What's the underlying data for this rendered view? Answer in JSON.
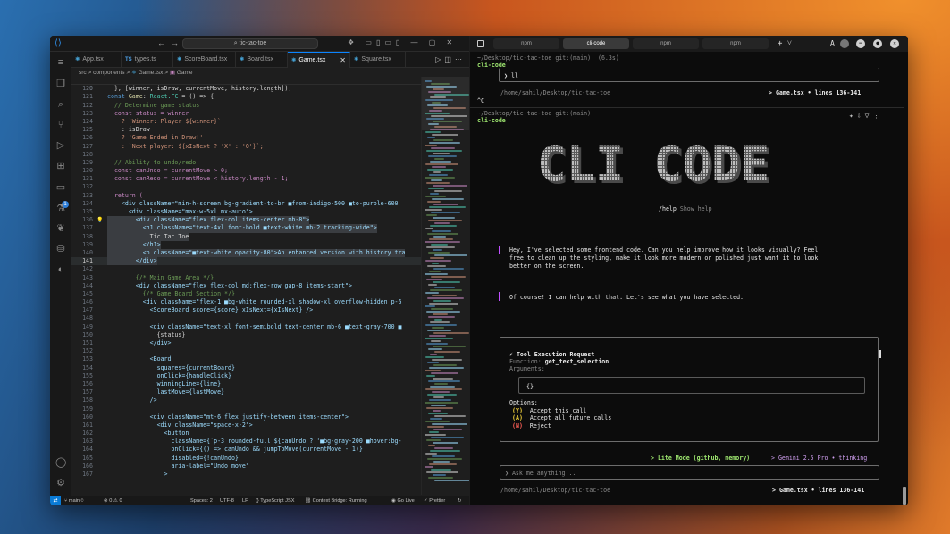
{
  "editor": {
    "search": "tic-tac-toe",
    "tabs": [
      {
        "icon": "⚛",
        "label": "App.tsx"
      },
      {
        "icon": "TS",
        "label": "types.ts"
      },
      {
        "icon": "⚛",
        "label": "ScoreBoard.tsx"
      },
      {
        "icon": "⚛",
        "label": "Board.tsx"
      },
      {
        "icon": "⚛",
        "label": "Game.tsx"
      },
      {
        "icon": "⚛",
        "label": "Square.tsx"
      }
    ],
    "breadcrumb": {
      "p1": "src",
      "p2": "components",
      "p3": "Game.tsx",
      "p4": "Game"
    },
    "sticky": {
      "ln": "9",
      "text": "const Game: React.FC = () => {"
    },
    "lines": [
      {
        "n": "120",
        "t": "  }, [winner, isDraw, currentMove, history.length]);"
      },
      {
        "n": "121",
        "t": ""
      },
      {
        "n": "122",
        "t": "  // Determine game status"
      },
      {
        "n": "123",
        "t": "  const status = winner"
      },
      {
        "n": "124",
        "t": "    ? `Winner: Player ${winner}`"
      },
      {
        "n": "125",
        "t": "    : isDraw"
      },
      {
        "n": "126",
        "t": "    ? 'Game Ended in Draw!'"
      },
      {
        "n": "127",
        "t": "    : `Next player: ${xIsNext ? 'X' : 'O'}`;"
      },
      {
        "n": "128",
        "t": ""
      },
      {
        "n": "129",
        "t": "  // Ability to undo/redo"
      },
      {
        "n": "130",
        "t": "  const canUndo = currentMove > 0;"
      },
      {
        "n": "131",
        "t": "  const canRedo = currentMove < history.length - 1;"
      },
      {
        "n": "132",
        "t": ""
      },
      {
        "n": "133",
        "t": "  return ("
      },
      {
        "n": "134",
        "t": "    <div className=\"min-h-screen bg-gradient-to-br ■from-indigo-500 ■to-purple-600"
      },
      {
        "n": "135",
        "t": "      <div className=\"max-w-5xl mx-auto\">"
      },
      {
        "n": "136",
        "t": "        <div className=\"flex flex-col items-center mb-8\">"
      },
      {
        "n": "137",
        "t": "          <h1 className=\"text-4xl font-bold ■text-white mb-2 tracking-wide\">"
      },
      {
        "n": "138",
        "t": "            Tic Tac Toe"
      },
      {
        "n": "139",
        "t": "          </h1>"
      },
      {
        "n": "140",
        "t": "          <p className=\"■text-white opacity-80\">An enhanced version with history tra"
      },
      {
        "n": "141",
        "t": "        </div>"
      },
      {
        "n": "142",
        "t": ""
      },
      {
        "n": "143",
        "t": "        {/* Main Game Area */}"
      },
      {
        "n": "144",
        "t": "        <div className=\"flex flex-col md:flex-row gap-8 items-start\">"
      },
      {
        "n": "145",
        "t": "          {/* Game Board Section */}"
      },
      {
        "n": "146",
        "t": "          <div className=\"flex-1 ■bg-white rounded-xl shadow-xl overflow-hidden p-6"
      },
      {
        "n": "147",
        "t": "            <ScoreBoard score={score} xIsNext={xIsNext} />"
      },
      {
        "n": "148",
        "t": ""
      },
      {
        "n": "149",
        "t": "            <div className=\"text-xl font-semibold text-center mb-6 ■text-gray-700 ■"
      },
      {
        "n": "150",
        "t": "              {status}"
      },
      {
        "n": "151",
        "t": "            </div>"
      },
      {
        "n": "152",
        "t": ""
      },
      {
        "n": "153",
        "t": "            <Board"
      },
      {
        "n": "154",
        "t": "              squares={currentBoard}"
      },
      {
        "n": "155",
        "t": "              onClick={handleClick}"
      },
      {
        "n": "156",
        "t": "              winningLine={line}"
      },
      {
        "n": "157",
        "t": "              lastMove={lastMove}"
      },
      {
        "n": "158",
        "t": "            />"
      },
      {
        "n": "159",
        "t": ""
      },
      {
        "n": "160",
        "t": "            <div className=\"mt-6 flex justify-between items-center\">"
      },
      {
        "n": "161",
        "t": "              <div className=\"space-x-2\">"
      },
      {
        "n": "162",
        "t": "                <button"
      },
      {
        "n": "163",
        "t": "                  className={`p-3 rounded-full ${canUndo ? '■bg-gray-200 ■hover:bg-"
      },
      {
        "n": "164",
        "t": "                  onClick={() => canUndo && jumpToMove(currentMove - 1)}"
      },
      {
        "n": "165",
        "t": "                  disabled={!canUndo}"
      },
      {
        "n": "166",
        "t": "                  aria-label=\"Undo move\""
      },
      {
        "n": "167",
        "t": "                >"
      }
    ],
    "status": {
      "branch": "main",
      "problems": "⊗ 0 ⚠ 0",
      "spaces": "Spaces: 2",
      "encoding": "UTF-8",
      "eol": "LF",
      "lang": "{} TypeScript JSX",
      "bridge": "Context Bridge: Running",
      "golive": "Go Live",
      "prettier": "✓ Prettier"
    }
  },
  "terminal": {
    "tabs": [
      "npm",
      "cli-code",
      "npm",
      "npm"
    ],
    "prompt1": "~/Desktop/tic-tac-toe git:(main)  (6.3s)",
    "cmd1": "cli-code",
    "input1": "❯ ll",
    "path1": "/home/sahil/Desktop/tic-tac-toe",
    "file1": "> Game.tsx • lines 136-141",
    "ctrlc": "^C",
    "prompt2": "~/Desktop/tic-tac-toe git:(main)",
    "cmd2": "cli-code",
    "logo_text": "CLI CODE",
    "help_cmd": "/help",
    "help_desc": "Show help",
    "user_msg": "Hey, I've selected some frontend code. Can you help improve how it looks visually? Feel\nfree to clean up the styling, make it look more modern or polished just want it to look\nbetter on the screen.",
    "ai_msg": "Of course! I can help with that. Let's see what you have selected.",
    "tool": {
      "title": "⚡ Tool Execution Request",
      "func_label": "Function:",
      "func": "get_text_selection",
      "args_label": "Arguments:",
      "args": "{}",
      "options_label": "Options:",
      "options": [
        {
          "key": "(Y)",
          "label": "Accept this call",
          "color": "#f3d23a"
        },
        {
          "key": "(A)",
          "label": "Accept all future calls",
          "color": "#f3d23a"
        },
        {
          "key": "(N)",
          "label": "Reject",
          "color": "#ff5f57"
        }
      ]
    },
    "mode": "> Lite Mode (github, memory)",
    "model": "> Gemini 2.5 Pro • thinking",
    "input_placeholder": "❯ Ask me anything...",
    "path2": "/home/sahil/Desktop/tic-tac-toe",
    "file2": "> Game.tsx • lines 136-141"
  }
}
